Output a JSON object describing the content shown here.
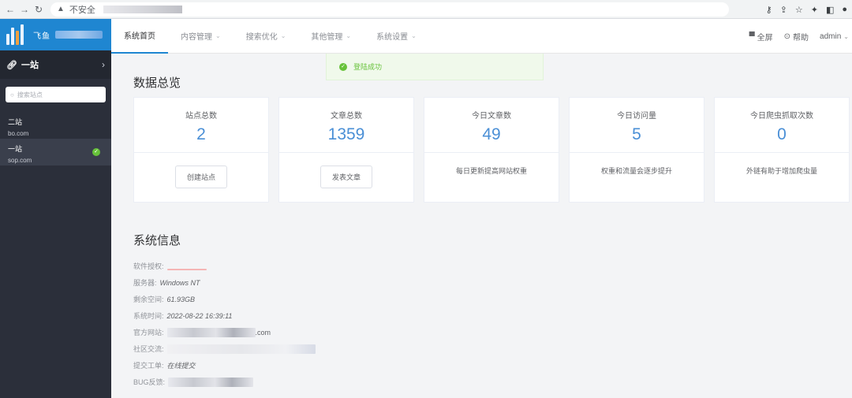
{
  "browser": {
    "security_label": "不安全"
  },
  "sidebar": {
    "logo_text": "飞鱼",
    "current_site": "一站",
    "search_placeholder": "搜索站点",
    "sites": [
      {
        "name": "二站",
        "domain": "bo.com"
      },
      {
        "name": "一站",
        "domain": "sop.com"
      }
    ]
  },
  "topnav": {
    "tabs": [
      {
        "label": "系统首页"
      },
      {
        "label": "内容管理"
      },
      {
        "label": "搜索优化"
      },
      {
        "label": "其他管理"
      },
      {
        "label": "系统设置"
      }
    ],
    "fullscreen": "全屏",
    "help": "帮助",
    "user": "admin"
  },
  "toast": {
    "message": "登陆成功"
  },
  "overview": {
    "title": "数据总览",
    "cards": [
      {
        "label": "站点总数",
        "value": "2",
        "button": "创建站点"
      },
      {
        "label": "文章总数",
        "value": "1359",
        "button": "发表文章"
      },
      {
        "label": "今日文章数",
        "value": "49",
        "hint": "每日更新提高网站权重"
      },
      {
        "label": "今日访问量",
        "value": "5",
        "hint": "权重和流量会逐步提升"
      },
      {
        "label": "今日爬虫抓取次数",
        "value": "0",
        "hint": "外链有助于增加爬虫量"
      }
    ]
  },
  "system": {
    "title": "系统信息",
    "license_label": "软件授权:",
    "server_label": "服务器:",
    "server_value": "Windows NT",
    "space_label": "剩余空间:",
    "space_value": "61.93GB",
    "time_label": "系统时间:",
    "time_value": "2022-08-22 16:39:11",
    "website_label": "官方网站:",
    "website_value": ".com",
    "community_label": "社区交流:",
    "ticket_label": "提交工单:",
    "ticket_value": "在线提交",
    "bug_label": "BUG反馈:"
  }
}
